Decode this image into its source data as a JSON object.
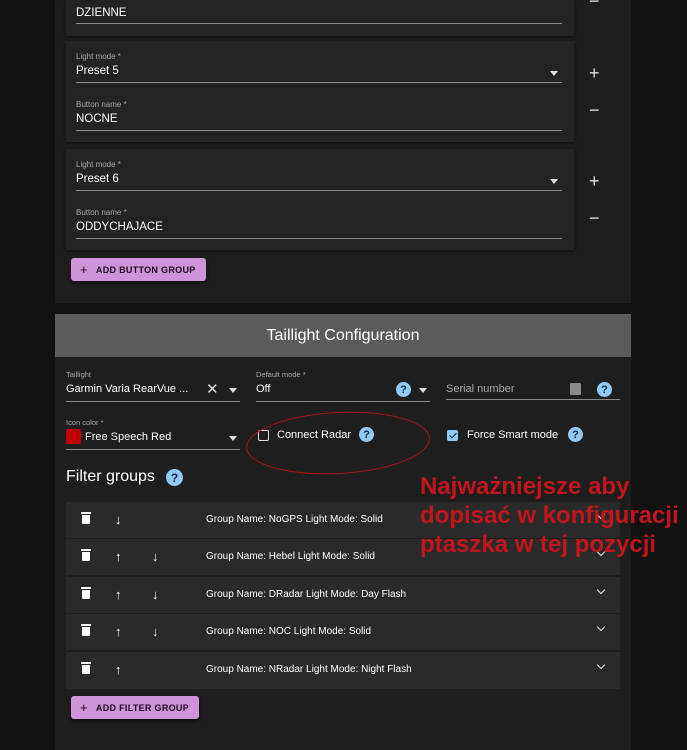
{
  "button_groups": [
    {
      "button_name_label": "",
      "button_name": "DZIENNE"
    },
    {
      "light_mode_label": "Light mode *",
      "light_mode": "Preset 5",
      "button_name_label": "Button name *",
      "button_name": "NOCNE"
    },
    {
      "light_mode_label": "Light mode *",
      "light_mode": "Preset 6",
      "button_name_label": "Button name *",
      "button_name": "ODDYCHAJACE"
    }
  ],
  "add_button_group_label": "ADD BUTTON GROUP",
  "taillight": {
    "header": "Taillight Configuration",
    "taillight_label": "Taillight",
    "taillight_value": "Garmin Varia RearVue ...",
    "default_mode_label": "Default mode *",
    "default_mode_value": "Off",
    "serial_placeholder": "Serial number",
    "icon_color_label": "Icon color *",
    "icon_color_value": "Free Speech Red",
    "icon_color_swatch": "#c00000",
    "connect_radar_label": "Connect Radar",
    "connect_radar_checked": false,
    "force_smart_label": "Force Smart mode",
    "force_smart_checked": true,
    "filter_groups_title": "Filter groups",
    "filter_groups": [
      {
        "name": "Group Name: NoGPS Light Mode: Solid",
        "up": false,
        "down": true
      },
      {
        "name": "Group Name: Hebel Light Mode: Solid",
        "up": true,
        "down": true
      },
      {
        "name": "Group Name: DRadar Light Mode: Day Flash",
        "up": true,
        "down": true
      },
      {
        "name": "Group Name: NOC Light Mode: Solid",
        "up": true,
        "down": true
      },
      {
        "name": "Group Name: NRadar Light Mode: Night Flash",
        "up": true,
        "down": false
      }
    ],
    "add_filter_group_label": "ADD FILTER GROUP"
  },
  "annotation_text": "Najważniejsze aby dopisać w konfiguracji ptaszka w tej pozycji",
  "colors": {
    "accent_purple": "#ce93d8",
    "help_blue": "#90caf9",
    "annotation_red": "#c0151c"
  }
}
